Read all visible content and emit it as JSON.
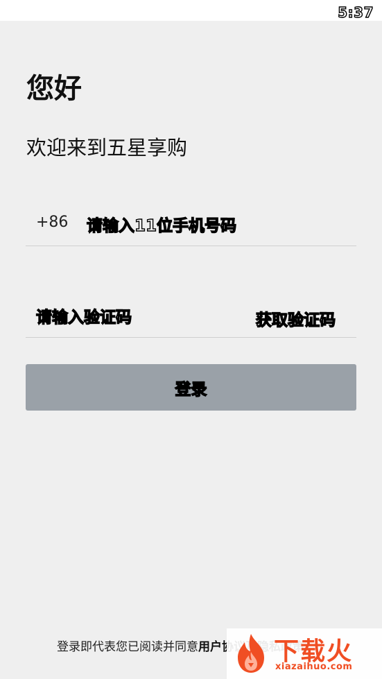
{
  "status_bar": {
    "time": "5:37"
  },
  "header": {
    "greeting": "您好",
    "welcome": "欢迎来到五星享购"
  },
  "phone_field": {
    "country_code": "+86",
    "placeholder": "请输入11位手机号码"
  },
  "code_field": {
    "placeholder": "请输入验证码",
    "get_code_label": "获取验证码"
  },
  "login_button": {
    "label": "登录"
  },
  "footer": {
    "agreement_text": "登录即代表您已阅读并同意",
    "agreement_link": "用户协议及隐私政策"
  },
  "watermark": {
    "brand": "下载火",
    "url": "xiazaihuo.com"
  },
  "colors": {
    "background": "#efefef",
    "button_disabled": "#9aa1a8",
    "divider": "#cfcfcf",
    "watermark_accent": "#f04e23"
  }
}
